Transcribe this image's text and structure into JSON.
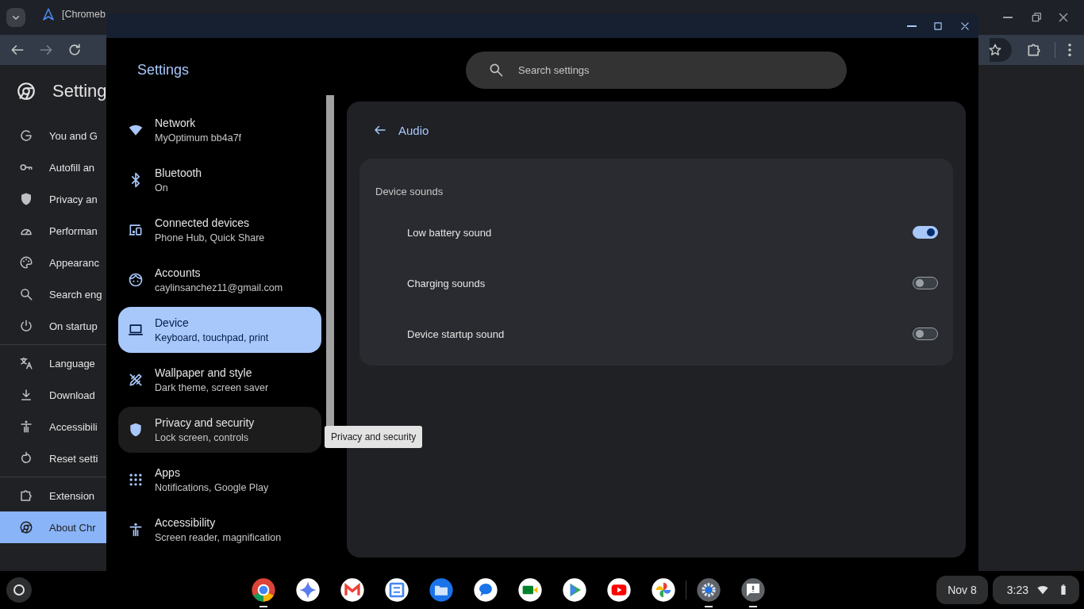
{
  "browser": {
    "tabs": [
      {
        "title": "[Chromeb",
        "selected": false
      }
    ],
    "page_heading": "Setting",
    "sidebar_sections": [
      {
        "items": [
          {
            "label": "You and G",
            "selected": false
          },
          {
            "label": "Autofill an",
            "selected": false
          },
          {
            "label": "Privacy an",
            "selected": false
          },
          {
            "label": "Performan",
            "selected": false
          },
          {
            "label": "Appearanc",
            "selected": false
          },
          {
            "label": "Search eng",
            "selected": false
          },
          {
            "label": "On startup",
            "selected": false
          }
        ]
      },
      {
        "items": [
          {
            "label": "Language",
            "selected": false
          },
          {
            "label": "Download",
            "selected": false
          },
          {
            "label": "Accessibili",
            "selected": false
          },
          {
            "label": "Reset setti",
            "selected": false
          }
        ]
      },
      {
        "items": [
          {
            "label": "Extension",
            "selected": false
          },
          {
            "label": "About Chr",
            "selected": true
          }
        ]
      }
    ]
  },
  "settings_app": {
    "title": "Settings",
    "search": {
      "placeholder": "Search settings"
    },
    "nav": [
      {
        "title": "Network",
        "subtitle": "MyOptimum bb4a7f",
        "selected": false,
        "hovered": false
      },
      {
        "title": "Bluetooth",
        "subtitle": "On",
        "selected": false,
        "hovered": false
      },
      {
        "title": "Connected devices",
        "subtitle": "Phone Hub, Quick Share",
        "selected": false,
        "hovered": false
      },
      {
        "title": "Accounts",
        "subtitle": "caylinsanchez11@gmail.com",
        "selected": false,
        "hovered": false
      },
      {
        "title": "Device",
        "subtitle": "Keyboard, touchpad, print",
        "selected": true,
        "hovered": false
      },
      {
        "title": "Wallpaper and style",
        "subtitle": "Dark theme, screen saver",
        "selected": false,
        "hovered": false
      },
      {
        "title": "Privacy and security",
        "subtitle": "Lock screen, controls",
        "selected": false,
        "hovered": true
      },
      {
        "title": "Apps",
        "subtitle": "Notifications, Google Play",
        "selected": false,
        "hovered": false
      },
      {
        "title": "Accessibility",
        "subtitle": "Screen reader, magnification",
        "selected": false,
        "hovered": false
      }
    ],
    "tooltip": "Privacy and security",
    "page": {
      "title": "Audio",
      "section_title": "Device sounds",
      "rows": [
        {
          "label": "Low battery sound",
          "on": true
        },
        {
          "label": "Charging sounds",
          "on": false
        },
        {
          "label": "Device startup sound",
          "on": false
        }
      ]
    }
  },
  "taskbar": {
    "apps": [
      {
        "kind": "ring",
        "running": true
      },
      {
        "kind": "sparkle",
        "running": false
      },
      {
        "kind": "mail",
        "running": false
      },
      {
        "kind": "calendar",
        "running": false
      },
      {
        "kind": "folder",
        "running": false
      },
      {
        "kind": "chat",
        "running": false
      },
      {
        "kind": "camera",
        "running": false
      },
      {
        "kind": "play",
        "running": false
      },
      {
        "kind": "video",
        "running": false
      },
      {
        "kind": "pinwheel",
        "running": false
      },
      {
        "kind": "gear",
        "running": true
      },
      {
        "kind": "feedback",
        "running": true
      }
    ],
    "date": "Nov 8",
    "time": "3:23"
  }
}
